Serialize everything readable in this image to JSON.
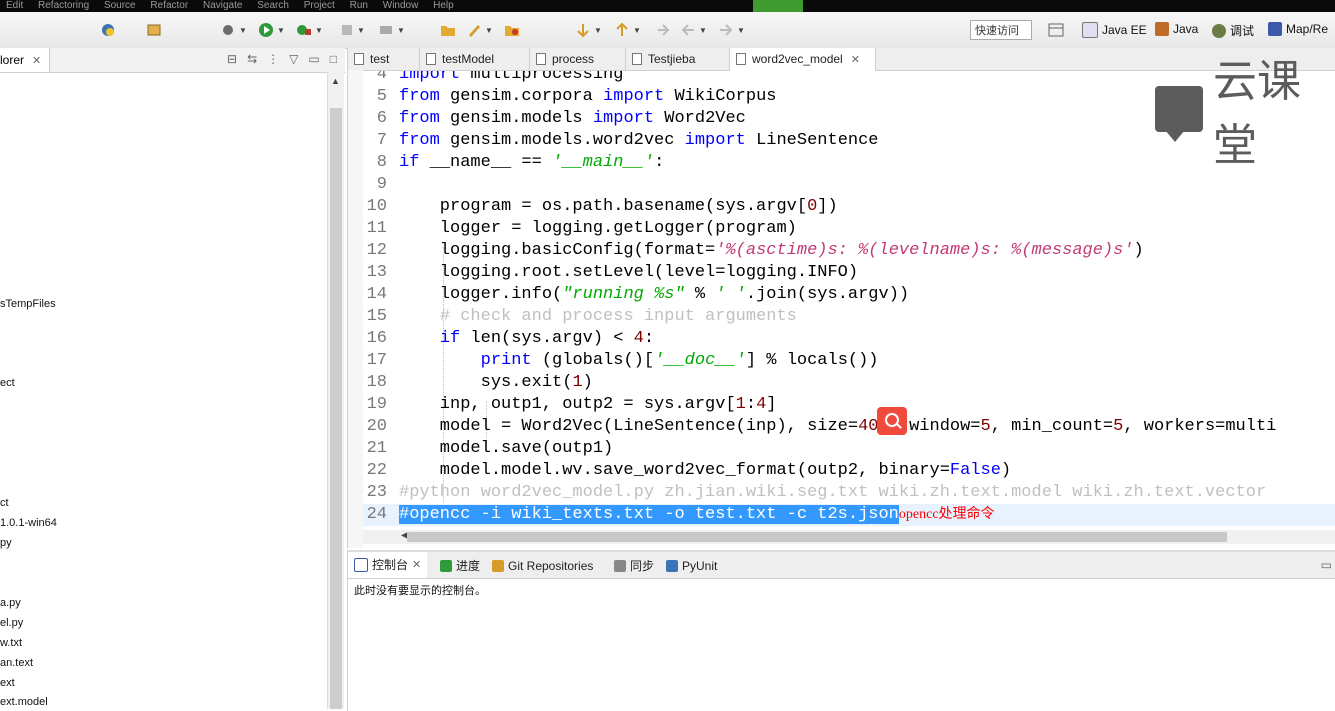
{
  "menubar": {
    "items": [
      "Edit",
      "Refactoring",
      "Source",
      "Refactor",
      "Navigate",
      "Search",
      "Project",
      "Run",
      "Window",
      "Help"
    ]
  },
  "toolbar": {
    "quick_access": "快速访问",
    "perspectives": [
      {
        "label": "Java EE",
        "icon": "java-ee-icon"
      },
      {
        "label": "Java",
        "icon": "java-icon"
      },
      {
        "label": "调试",
        "icon": "debug-icon"
      },
      {
        "label": "Map/Re",
        "icon": "mapreduce-icon"
      }
    ]
  },
  "left_panel": {
    "tab_label": "lorer",
    "tree_items": [
      "sTempFiles",
      "ect",
      "ct",
      "1.0.1-win64",
      "py",
      "a.py",
      "el.py",
      "w.txt",
      "an.text",
      "ext",
      "ext.model"
    ]
  },
  "editor": {
    "tabs": [
      "test",
      "testModel",
      "process",
      "Testjieba",
      "word2vec_model"
    ],
    "active_tab": "word2vec_model",
    "annotation": "opencc处理命令",
    "lines": [
      {
        "n": "4",
        "text": "import multiprocessing"
      },
      {
        "n": "5",
        "text": "from gensim.corpora import WikiCorpus"
      },
      {
        "n": "6",
        "text": "from gensim.models import Word2Vec"
      },
      {
        "n": "7",
        "text": "from gensim.models.word2vec import LineSentence"
      },
      {
        "n": "8",
        "text": "if __name__ == '__main__':"
      },
      {
        "n": "9",
        "text": ""
      },
      {
        "n": "10",
        "text": "    program = os.path.basename(sys.argv[0])"
      },
      {
        "n": "11",
        "text": "    logger = logging.getLogger(program)"
      },
      {
        "n": "12",
        "text": "    logging.basicConfig(format='%(asctime)s: %(levelname)s: %(message)s')"
      },
      {
        "n": "13",
        "text": "    logging.root.setLevel(level=logging.INFO)"
      },
      {
        "n": "14",
        "text": "    logger.info(\"running %s\" % ' '.join(sys.argv))"
      },
      {
        "n": "15",
        "text": "    # check and process input arguments"
      },
      {
        "n": "16",
        "text": "    if len(sys.argv) < 4:"
      },
      {
        "n": "17",
        "text": "        print (globals()['__doc__'] % locals())"
      },
      {
        "n": "18",
        "text": "        sys.exit(1)"
      },
      {
        "n": "19",
        "text": "    inp, outp1, outp2 = sys.argv[1:4]"
      },
      {
        "n": "20",
        "text": "    model = Word2Vec(LineSentence(inp), size=400, window=5, min_count=5, workers=multi"
      },
      {
        "n": "21",
        "text": "    model.save(outp1)"
      },
      {
        "n": "22",
        "text": "    model.model.wv.save_word2vec_format(outp2, binary=False)"
      },
      {
        "n": "23",
        "text": "#python word2vec_model.py zh.jian.wiki.seg.txt wiki.zh.text.model wiki.zh.text.vector"
      },
      {
        "n": "24",
        "text": "#opencc -i wiki_texts.txt -o test.txt -c t2s.json"
      }
    ]
  },
  "watermark": {
    "text": "云课堂"
  },
  "console": {
    "tabs": [
      "控制台",
      "进度",
      "Git Repositories",
      "同步",
      "PyUnit"
    ],
    "message": "此时没有要显示的控制台。"
  }
}
